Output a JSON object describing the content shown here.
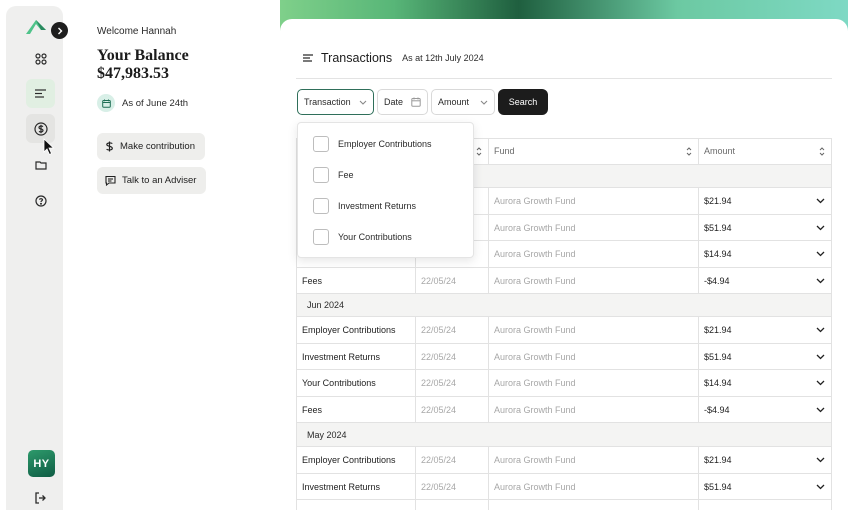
{
  "sidebar": {
    "avatar_initials": "HY",
    "nav_icons": [
      "grid-icon",
      "list-icon",
      "dollar-icon",
      "folder-icon",
      "help-icon"
    ]
  },
  "profile": {
    "welcome": "Welcome Hannah",
    "balance_title": "Your Balance",
    "balance_value": "$47,983.53",
    "as_of": "As of June 24th",
    "make_contribution": "Make contribution",
    "talk_to_adviser": "Talk to an Adviser"
  },
  "transactions": {
    "title": "Transactions",
    "subtitle": "As at 12th July 2024",
    "filters": {
      "transaction": "Transaction",
      "date": "Date",
      "amount": "Amount",
      "search": "Search"
    },
    "dropdown_options": [
      "Employer Contributions",
      "Fee",
      "Investment Returns",
      "Your Contributions"
    ],
    "columns": [
      "Fund",
      "Amount"
    ],
    "upper_rows": [
      {
        "fund": "Aurora Growth Fund",
        "amount": "$21.94"
      },
      {
        "fund": "Aurora Growth Fund",
        "amount": "$51.94"
      },
      {
        "fund": "Aurora Growth Fund",
        "amount": "$14.94"
      },
      {
        "type": "Fees",
        "date": "22/05/24",
        "fund": "Aurora Growth Fund",
        "amount": "-$4.94"
      }
    ],
    "groups": [
      {
        "label": "Jun 2024",
        "rows": [
          {
            "type": "Employer Contributions",
            "date": "22/05/24",
            "fund": "Aurora Growth Fund",
            "amount": "$21.94"
          },
          {
            "type": "Investment Returns",
            "date": "22/05/24",
            "fund": "Aurora Growth Fund",
            "amount": "$51.94"
          },
          {
            "type": "Your Contributions",
            "date": "22/05/24",
            "fund": "Aurora Growth Fund",
            "amount": "$14.94"
          },
          {
            "type": "Fees",
            "date": "22/05/24",
            "fund": "Aurora Growth Fund",
            "amount": "-$4.94"
          }
        ]
      },
      {
        "label": "May 2024",
        "rows": [
          {
            "type": "Employer Contributions",
            "date": "22/05/24",
            "fund": "Aurora Growth Fund",
            "amount": "$21.94"
          },
          {
            "type": "Investment Returns",
            "date": "22/05/24",
            "fund": "Aurora Growth Fund",
            "amount": "$51.94"
          }
        ]
      }
    ]
  },
  "colors": {
    "accent_green": "#2f6f5a",
    "active_nav_bg": "#e1efe2",
    "button_dark": "#1c1c1c"
  }
}
